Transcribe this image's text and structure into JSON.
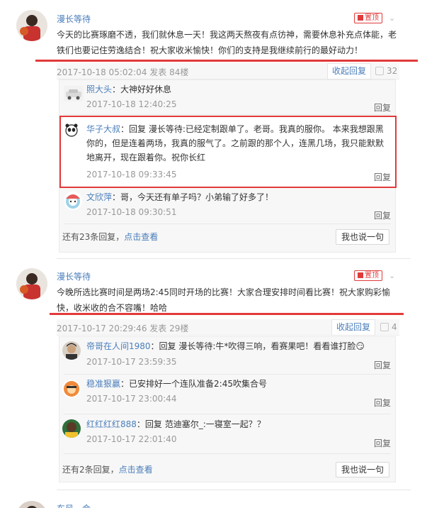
{
  "posts": [
    {
      "author": "漫长等待",
      "pin_label": "置顶",
      "content_line1": "今天的比赛琢磨不透，我们就休息一天！我这两天熬夜有点彷神，需要休息补充点体能，老",
      "content_line2": "铁们也要记住劳逸结合！祝大家收米愉快！你们的支持是我继续前行的最好动力！",
      "date": "2017-10-18 05:02:04 发表  84楼",
      "fold_label": "收起回复",
      "likes": "32",
      "replies": [
        {
          "name": "照大头",
          "text": "：大神好好休息",
          "time": "2017-10-18 12:40:25",
          "reply_label": "回复"
        },
        {
          "name": "华子大叔",
          "text_line1": "：回复 漫长等待:已经定制跟单了。老哥。我真的服你。 本来我想跟黑",
          "text_line2": "你的，但是连着两场，我真的服气了。之前跟的那个人，连黑几场，我只能默默",
          "text_line3": "地离开，现在跟着你。祝你长红",
          "time": "2017-10-18 09:33:45",
          "reply_label": "回复"
        },
        {
          "name": "文欣萍",
          "text": "：哥，今天还有单子吗？小弟输了好多了！",
          "time": "2017-10-18 09:30:51",
          "reply_label": "回复"
        }
      ],
      "more_prefix": "还有23条回复，",
      "more_link": "点击查看",
      "say_label": "我也说一句"
    },
    {
      "author": "漫长等待",
      "pin_label": "置顶",
      "content_line1": "今晚所选比赛时间是两场2:45同时开场的比赛！大家合理安排时间看比赛！祝大家购彩愉",
      "content_line2": "快，收米收的合不容嘴！哈哈",
      "date": "2017-10-17 20:29:46 发表  29楼",
      "fold_label": "收起回复",
      "likes": "4",
      "replies": [
        {
          "name": "帝哥在人间1980",
          "text": "：回复 漫长等待:牛*吹得三响，看赛果吧！看看谁打脸",
          "emoji": "😏",
          "time": "2017-10-17 23:59:35",
          "reply_label": "回复"
        },
        {
          "name": "稳准狠赢",
          "text": "：已安排好一个连队准备2:45吹集合号",
          "time": "2017-10-17 23:00:44",
          "reply_label": "回复"
        },
        {
          "name": "红红红红888",
          "text": "：回复 范迪塞尔_:一寝室一起？？",
          "time": "2017-10-17 22:01:40",
          "reply_label": "回复"
        }
      ],
      "more_prefix": "还有2条回复，",
      "more_link": "点击查看",
      "say_label": "我也说一句"
    }
  ],
  "partial_author": "东风一会",
  "colors": {
    "accent": "#4a7ebb",
    "highlight": "#e23a3a",
    "meta": "#999999"
  }
}
